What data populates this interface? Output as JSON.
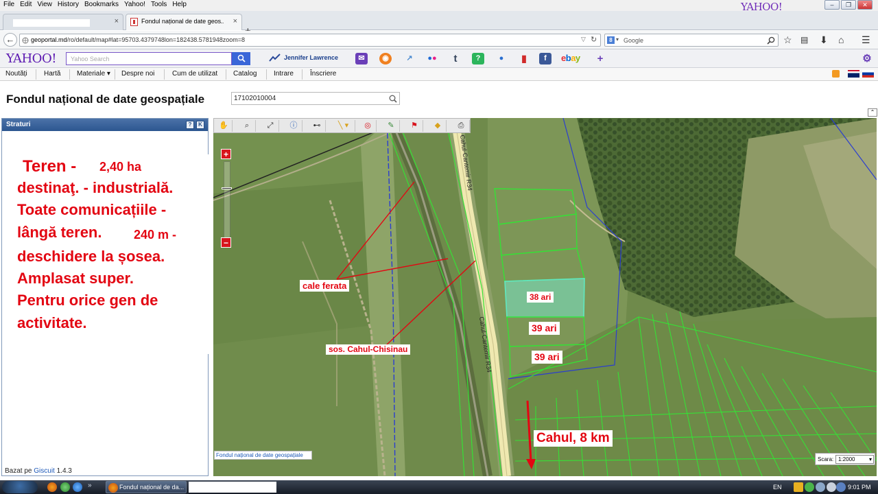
{
  "browser": {
    "menu": [
      "File",
      "Edit",
      "View",
      "History",
      "Bookmarks",
      "Yahoo!",
      "Tools",
      "Help"
    ],
    "brand": "YAHOO!",
    "tabs": [
      {
        "title": ""
      },
      {
        "title": "Fondul național de date geos..."
      }
    ],
    "url_host": "geoportal.md",
    "url_path": "/ro/default/map#lat=95703.4379748lon=182438.5781948zoom=8",
    "search_engine_badge": "8",
    "search_placeholder": "Google"
  },
  "yahoo_toolbar": {
    "logo": "YAHOO!",
    "search_placeholder": "Yahoo Search",
    "trending": "Jennifer Lawrence",
    "ebay": "ebay"
  },
  "site_menu": [
    "Noutăți",
    "Hartă",
    "Materiale ▾",
    "Despre noi",
    "Cum de utilizat",
    "Catalog",
    "Intrare",
    "Înscriere"
  ],
  "page": {
    "title": "Fondul național de date geospațiale",
    "search_value": "17102010004"
  },
  "layers_panel": {
    "title": "Straturi",
    "help_btn": "?",
    "collapse_btn": "K",
    "powered_prefix": "Bazat pe",
    "powered_link": "Giscuit",
    "powered_version": "1.4.3"
  },
  "ad": {
    "l1a": "Teren -",
    "l1b": "2,40 ha",
    "l2": "destinaţ. - industrială.",
    "l3": "Toate comunicațiile -",
    "l4a": "lângă teren.",
    "l4b": "240 m  -",
    "l5": "deschidere la șosea.",
    "l6": "Amplasat super.",
    "l7": "Pentru orice gen de",
    "l8": "activitate."
  },
  "map": {
    "road_label_top": "Cahul-Cantemir R34",
    "road_label_bottom": "Cahul-Cantemir R34",
    "label_rail": "cale ferata",
    "label_road": "sos. Cahul-Chisinau",
    "parcel_1": "38 ari",
    "parcel_2": "39 ari",
    "parcel_3": "39 ari",
    "direction": "Cahul, 8 km",
    "attribution": "Fondul național de date geospațiale",
    "scale_label": "Scara:",
    "scale_value": "1:2000",
    "zoom_in": "+",
    "zoom_out": "−"
  },
  "taskbar": {
    "task_title": "Fondul național de da...",
    "lang": "EN",
    "time": "9:01 PM"
  },
  "colors": {
    "ad_red": "#e30612",
    "parcel_green": "#36e036",
    "yahoo_purple": "#5a16b0"
  }
}
